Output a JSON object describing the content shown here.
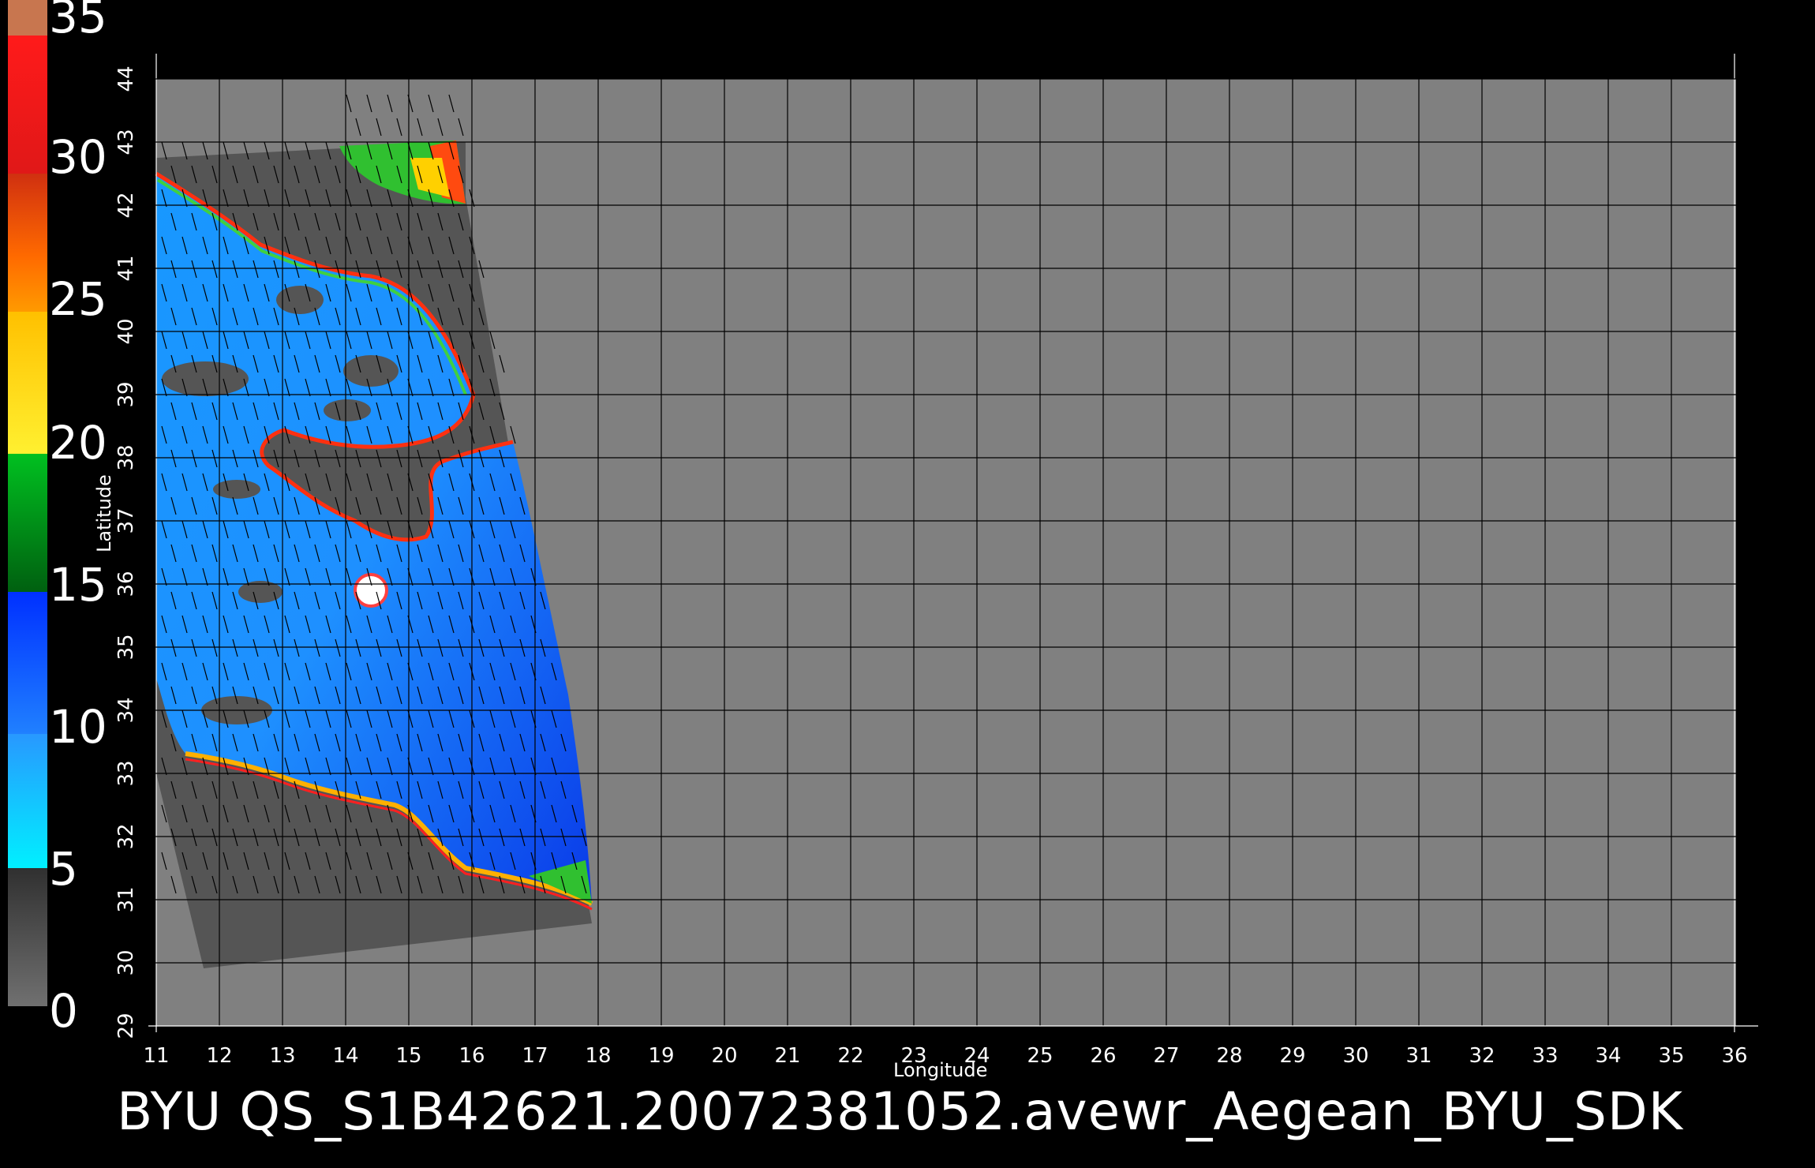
{
  "colorbar": {
    "labels": [
      "35",
      "30",
      "25",
      "20",
      "15",
      "10",
      "5",
      "0"
    ],
    "colors": [
      "#C8764F",
      "#FF2020",
      "#FF6A00",
      "#FFE000",
      "#00A000",
      "#0050FF",
      "#00E8FF",
      "#505050"
    ]
  },
  "axes": {
    "x_title": "Longitude",
    "y_title": "Latitude",
    "x_ticks": [
      "11",
      "12",
      "13",
      "14",
      "15",
      "16",
      "17",
      "18",
      "19",
      "20",
      "21",
      "22",
      "23",
      "24",
      "25",
      "26",
      "27",
      "28",
      "29",
      "30",
      "31",
      "32",
      "33",
      "34",
      "35",
      "36"
    ],
    "y_ticks": [
      "29",
      "30",
      "31",
      "32",
      "33",
      "34",
      "35",
      "36",
      "37",
      "38",
      "39",
      "40",
      "41",
      "42",
      "43",
      "44"
    ]
  },
  "map": {
    "background_color": "#808080",
    "swath_color": "#555555",
    "grid_color": "#000000"
  },
  "caption": "BYU  QS_S1B42621.20072381052.avewr_Aegean_BYU_SDK"
}
